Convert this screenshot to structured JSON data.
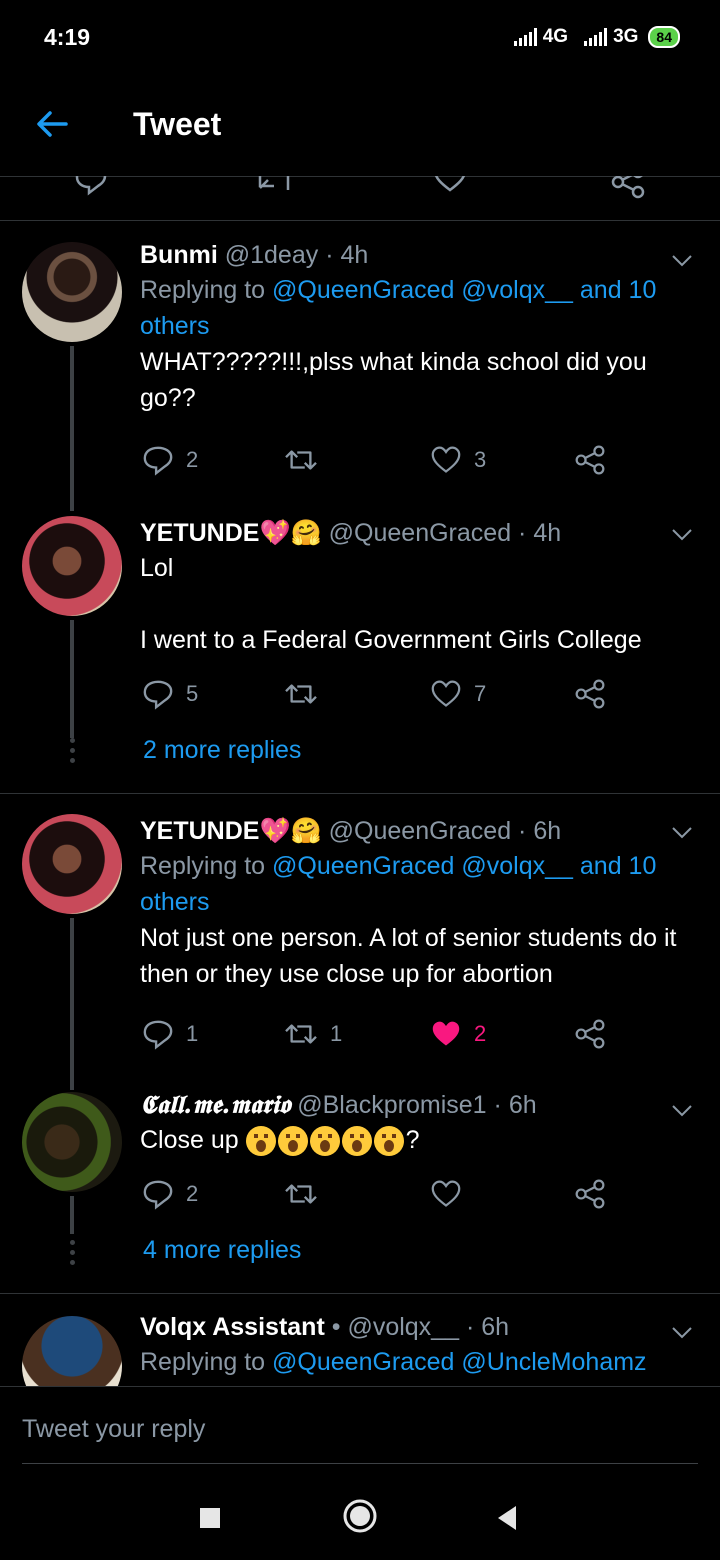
{
  "status_bar": {
    "time": "4:19",
    "network1": "4G",
    "network2": "3G",
    "battery": "84"
  },
  "app_bar": {
    "title": "Tweet"
  },
  "tweets": [
    {
      "name": "Bunmi",
      "handle": "@1deay",
      "sep": "·",
      "time": "4h",
      "replying_prefix": "Replying to",
      "mentions": "@QueenGraced @volqx__ and 10 others",
      "body": "WHAT?????!!!,plss what kinda school did you go??",
      "replies": "2",
      "retweets": "",
      "likes": "3"
    },
    {
      "name": "YETUNDE💖🤗",
      "handle": "@QueenGraced",
      "sep": "·",
      "time": "4h",
      "body_line1": "Lol",
      "body_line2": "I went to a Federal Government Girls College",
      "replies": "5",
      "retweets": "",
      "likes": "7",
      "more_replies": "2 more replies"
    },
    {
      "name": "YETUNDE💖🤗",
      "handle": "@QueenGraced",
      "sep": "·",
      "time": "6h",
      "replying_prefix": "Replying to",
      "mentions": "@QueenGraced @volqx__ and 10 others",
      "body": "Not just one person. A lot of senior students do it then or they use close up for abortion",
      "replies": "1",
      "retweets": "1",
      "likes": "2",
      "liked": true
    },
    {
      "name": "𝕮𝖆𝖑𝖑.𝖒𝖊.𝖒𝖆𝖗𝖎𝖔",
      "handle": "@Blackpromise1",
      "sep": "·",
      "time": "6h",
      "body": "Close up",
      "body_suffix": "?",
      "replies": "2",
      "retweets": "",
      "likes": "",
      "more_replies": "4 more replies"
    },
    {
      "name": "Volqx Assistant",
      "bullet": "•",
      "handle": "@volqx__",
      "sep": "·",
      "time": "6h",
      "replying_prefix": "Replying to",
      "mentions": "@QueenGraced @UncleMohamz"
    }
  ],
  "composer": {
    "placeholder": "Tweet your reply"
  },
  "colors": {
    "accent": "#1d9bf0",
    "like": "#f91880",
    "muted": "#8b98a5",
    "background": "#000000"
  }
}
